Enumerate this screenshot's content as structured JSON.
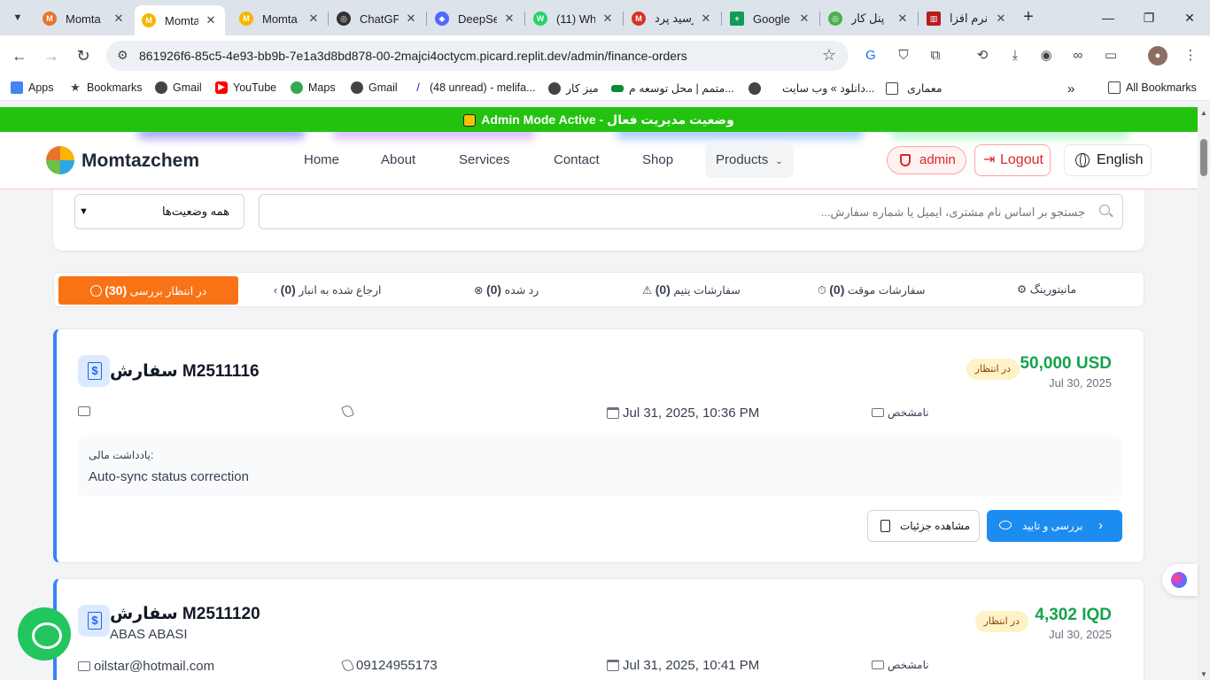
{
  "browser": {
    "tabs": [
      {
        "title": "Momta",
        "color": "#e8742b",
        "glyph": "M"
      },
      {
        "title": "Momta",
        "color": "#f7b500",
        "glyph": "M",
        "active": true
      },
      {
        "title": "Momta",
        "color": "#f7b500",
        "glyph": "M"
      },
      {
        "title": "ChatGP",
        "color": "#333333",
        "glyph": "◎"
      },
      {
        "title": "DeepSe",
        "color": "#4d6bfe",
        "glyph": "◆"
      },
      {
        "title": "(11) Wh",
        "color": "#25d366",
        "glyph": "W"
      },
      {
        "title": "رسید پرد",
        "color": "#d93025",
        "glyph": "M"
      },
      {
        "title": "Google",
        "color": "#0f9d58",
        "glyph": "+"
      },
      {
        "title": "پنل کار",
        "color": "#4caf50",
        "glyph": "◎"
      },
      {
        "title": "نرم افزا",
        "color": "#b71c1c",
        "glyph": "▥"
      }
    ],
    "url": "861926f6-85c5-4e93-bb9b-7e1a3d8bd878-00-2majci4octycm.picard.replit.dev/admin/finance-orders",
    "bookmarks": [
      {
        "label": "Apps",
        "color": "#4285f4"
      },
      {
        "label": "Bookmarks",
        "color": "#444444"
      },
      {
        "label": "Gmail",
        "color": "#444444"
      },
      {
        "label": "YouTube",
        "color": "#ff0000"
      },
      {
        "label": "Maps",
        "color": "#34a853"
      },
      {
        "label": "Gmail",
        "color": "#444444"
      },
      {
        "label": "(48 unread) - melifa...",
        "color": "#6001d2"
      },
      {
        "label": "میز کار",
        "color": "#444444"
      },
      {
        "label": "متمم | محل توسعه م...",
        "color": "#0a8a3a"
      },
      {
        "label": "دانلود » وب سایت...",
        "color": "#444444"
      },
      {
        "label": "معماری",
        "color": "#444444"
      }
    ],
    "all_bookmarks": "All Bookmarks"
  },
  "banner": {
    "text": "Admin Mode Active - وضعیت مدیریت فعال"
  },
  "nav": {
    "brand": "Momtazchem",
    "links": [
      "Home",
      "About",
      "Services",
      "Contact",
      "Shop"
    ],
    "products": "Products",
    "admin_label": "admin",
    "logout": "Logout",
    "language": "English"
  },
  "filters": {
    "status_select": "همه وضعیت‌ها",
    "search_placeholder": "جستجو بر اساس نام مشتری، ایمیل یا شماره سفارش..."
  },
  "status_tabs": [
    {
      "label": "در انتظار بررسی",
      "count": "(30)"
    },
    {
      "label": "ارجاع شده به انبار",
      "count": "(0)"
    },
    {
      "label": "رد شده",
      "count": "(0)"
    },
    {
      "label": "سفارشات یتیم",
      "count": "(0)"
    },
    {
      "label": "سفارشات موقت",
      "count": "(0)"
    },
    {
      "label": "مانیتورینگ",
      "count": ""
    }
  ],
  "orders": [
    {
      "title": "سفارش M2511116",
      "customer": "",
      "amount": "50,000 USD",
      "status": "در انتظار",
      "date": "Jul 30, 2025",
      "email": "",
      "phone": "",
      "datetime": "Jul 31, 2025, 10:36 PM",
      "payment": "نامشخص",
      "note_label": "یادداشت مالی:",
      "note": "Auto-sync status correction",
      "details_label": "مشاهده جزئیات",
      "review_label": "بررسی و تایید"
    },
    {
      "title": "سفارش M2511120",
      "customer": "ABAS ABASI",
      "amount": "4,302 IQD",
      "status": "در انتظار",
      "date": "Jul 30, 2025",
      "email": "oilstar@hotmail.com",
      "phone": "09124955173",
      "datetime": "Jul 31, 2025, 10:41 PM",
      "payment": "نامشخص"
    }
  ]
}
